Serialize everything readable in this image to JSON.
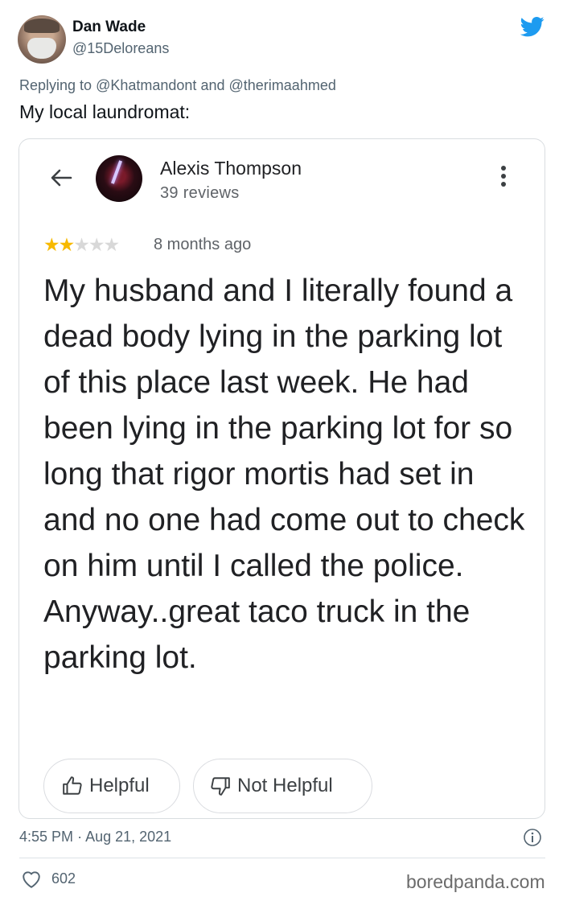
{
  "tweet": {
    "author_name": "Dan Wade",
    "author_handle": "@15Deloreans",
    "replying_prefix": "Replying to",
    "replying_mention_1": "@Khatmandont",
    "replying_and": "and",
    "replying_mention_2": "@therimaahmed",
    "text": "My local laundromat:",
    "time": "4:55 PM",
    "separator": "·",
    "date": "Aug 21, 2021",
    "likes": "602",
    "brand_color": "#1d9bf0"
  },
  "review": {
    "reviewer_name": "Alexis Thompson",
    "reviewer_reviews": "39 reviews",
    "rating": 2,
    "rating_max": 5,
    "age": "8 months ago",
    "body": "My husband and I literally found a dead body lying in the parking lot of this place last week. He had been lying in the parking lot for so long that rigor mortis had set in and no one had come out to check on him until I called the police. Anyway..great taco truck in the parking lot.",
    "helpful_label": "Helpful",
    "not_helpful_label": "Not Helpful",
    "star_color": "#f7b900"
  },
  "watermark": "boredpanda.com"
}
